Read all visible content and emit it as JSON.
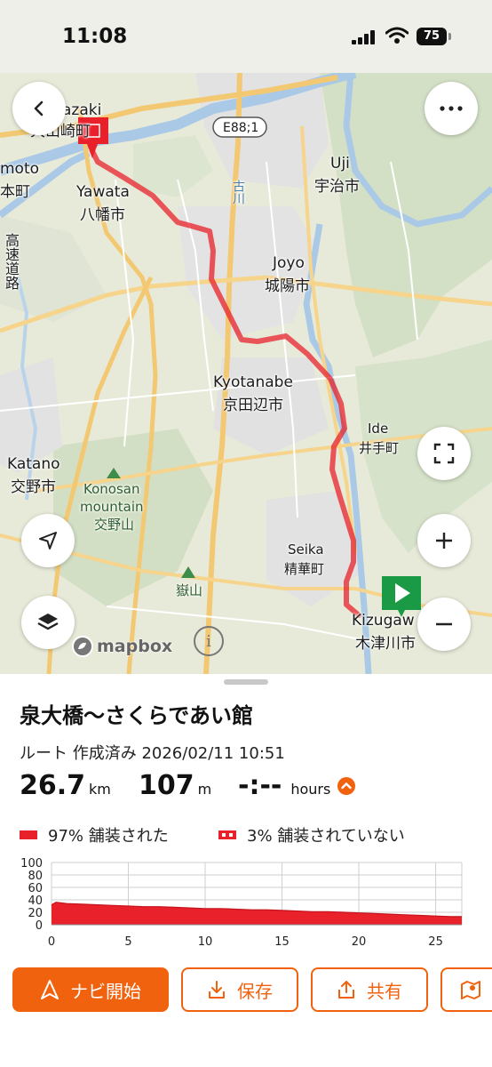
{
  "status_bar": {
    "time": "11:08",
    "battery": "75"
  },
  "map": {
    "road_shield": "E88;1",
    "labels": {
      "yamazaki": "azaki",
      "yamazaki_jp": "大山崎町",
      "shimamoto": "moto",
      "shimamoto_jp": "本町",
      "highway_jp": "高速道路",
      "yawata": "Yawata",
      "yawata_jp": "八幡市",
      "uji": "Uji",
      "uji_jp": "宇治市",
      "furukawa_jp": "古川",
      "joyo": "Joyo",
      "joyo_jp": "城陽市",
      "kyotanabe": "Kyotanabe",
      "kyotanabe_jp": "京田辺市",
      "ide": "Ide",
      "ide_jp": "井手町",
      "katano": "Katano",
      "katano_jp": "交野市",
      "konosan": "Konosan",
      "mountain": "mountain",
      "konosan_jp": "交野山",
      "seika": "Seika",
      "seika_jp": "精華町",
      "takeyama_jp": "嶽山",
      "kizugawa": "Kizugaw",
      "kizugawa_jp": "木津川市"
    },
    "attribution": "mapbox",
    "info_glyph": "i"
  },
  "route": {
    "title": "泉大橋〜さくらであい館",
    "meta": "ルート 作成済み 2026/02/11 10:51",
    "distance_value": "26.7",
    "distance_unit": "km",
    "elevation_value": "107",
    "elevation_unit": "m",
    "duration_value": "-:--",
    "duration_unit": "hours",
    "paved_label": "97% 舗装された",
    "unpaved_label": "3% 舗装されていない"
  },
  "buttons": {
    "navigate": "ナビ開始",
    "save": "保存",
    "share": "共有"
  },
  "colors": {
    "accent": "#f0620e",
    "route": "#e8212b"
  },
  "chart_data": {
    "type": "area",
    "xlabel": "",
    "ylabel": "",
    "xlim": [
      0,
      26.7
    ],
    "ylim": [
      0,
      100
    ],
    "x_ticks": [
      "0",
      "5",
      "10",
      "15",
      "20",
      "25"
    ],
    "y_ticks": [
      "100",
      "80",
      "60",
      "40",
      "20",
      "0"
    ],
    "grid": true,
    "series": [
      {
        "x": [
          0,
          0.3,
          1,
          2,
          3,
          4,
          5,
          6,
          7,
          8,
          9,
          10,
          11,
          12,
          13,
          14,
          15,
          16,
          17,
          18,
          19,
          20,
          21,
          22,
          23,
          24,
          25,
          26,
          26.7
        ],
        "values": [
          32,
          36,
          34,
          33,
          32,
          31,
          30,
          29,
          29,
          28,
          27,
          26,
          26,
          25,
          24,
          24,
          23,
          22,
          21,
          21,
          20,
          19,
          18,
          17,
          16,
          15,
          14,
          13,
          13
        ]
      }
    ]
  }
}
